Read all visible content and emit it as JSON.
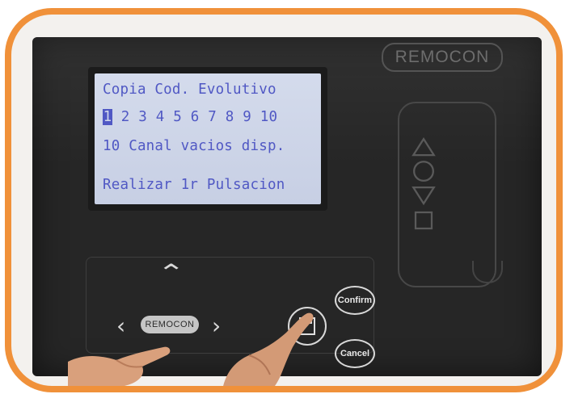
{
  "brand": {
    "top_logo": "REMOCON",
    "pad_logo": "REMOCON"
  },
  "lcd": {
    "line1": "Copia Cod. Evolutivo",
    "channels": [
      "1",
      "2",
      "3",
      "4",
      "5",
      "6",
      "7",
      "8",
      "9",
      "10"
    ],
    "selected_channel": "1",
    "line3": "10 Canal vacios disp.",
    "line4": "Realizar 1r Pulsacion"
  },
  "buttons": {
    "confirm": "Confirm",
    "cancel": "Cancel"
  },
  "colors": {
    "frame": "#f0913a",
    "device": "#262626",
    "lcd_background": "#cdd4e8",
    "lcd_text": "#5058c4"
  },
  "icons": [
    "up-arrow-icon",
    "left-arrow-icon",
    "right-arrow-icon",
    "save-icon",
    "remote-triangle-up-icon",
    "remote-circle-icon",
    "remote-triangle-down-icon",
    "remote-square-icon"
  ]
}
